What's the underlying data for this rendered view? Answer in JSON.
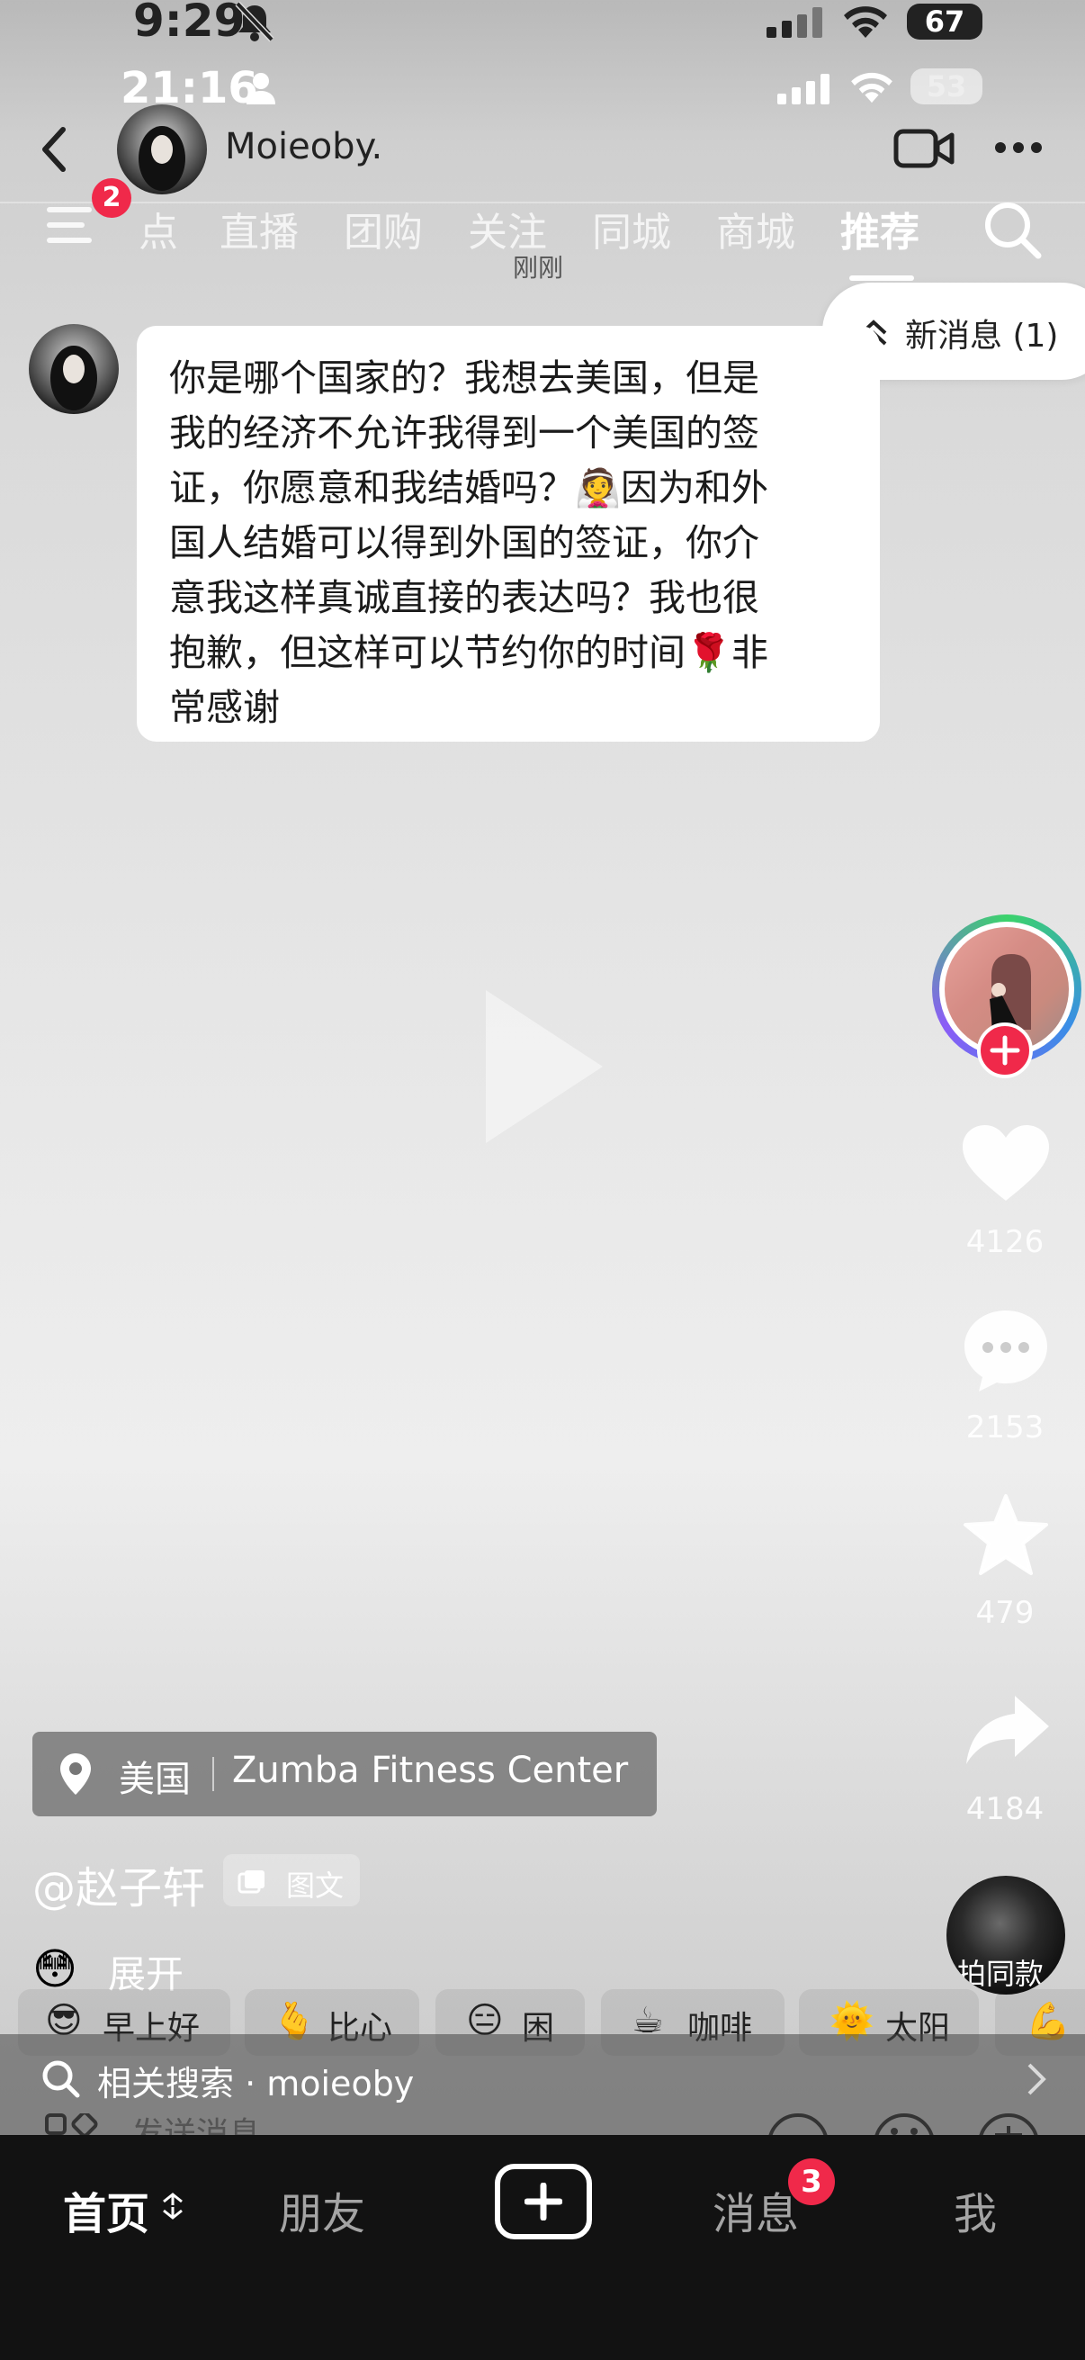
{
  "status_outer": {
    "time": "9:29",
    "battery": "67"
  },
  "status_inner": {
    "time": "21:16",
    "battery": "53"
  },
  "chat_header": {
    "name": "Moieoby."
  },
  "tabs": {
    "menu_badge": "2",
    "items": [
      "点",
      "直播",
      "团购",
      "关注",
      "同城",
      "商城",
      "推荐"
    ],
    "active": "推荐",
    "timestamp": "刚刚"
  },
  "new_message": {
    "label": "新消息 (1)"
  },
  "message": {
    "lines": [
      "你是哪个国家的？我想去美国，但是",
      "我的经济不允许我得到一个美国的签",
      "证，你愿意和我结婚吗？👰因为和外",
      "国人结婚可以得到外国的签证，你介",
      "意我这样真诚直接的表达吗？我也很",
      "抱歉，但这样可以节约你的时间🌹非",
      "常感谢"
    ]
  },
  "actions": {
    "likes": "4126",
    "comments": "2153",
    "favorites": "479",
    "shares": "4184",
    "same_style": "拍同款"
  },
  "location": {
    "country": "美国",
    "place": "Zumba Fitness Center"
  },
  "author": {
    "handle": "@赵子轩",
    "type_tag": "图文"
  },
  "expand": {
    "emoji": "😳",
    "label": "展开"
  },
  "quick_replies": [
    {
      "emoji": "😎",
      "label": "早上好"
    },
    {
      "emoji": "🫰",
      "label": "比心"
    },
    {
      "emoji": "😑",
      "label": "困"
    },
    {
      "emoji": "☕",
      "label": "咖啡"
    },
    {
      "emoji": "🌞",
      "label": "太阳"
    },
    {
      "emoji": "💪",
      "label": ""
    }
  ],
  "related_search": {
    "label": "相关搜索 · moieoby"
  },
  "composer": {
    "placeholder": "发送消息"
  },
  "bottom_nav": {
    "home": "首页",
    "friends": "朋友",
    "messages": "消息",
    "messages_badge": "3",
    "me": "我"
  },
  "colors": {
    "accent": "#f0294a",
    "nav_bg": "#121212",
    "bubble": "#ffffff"
  }
}
